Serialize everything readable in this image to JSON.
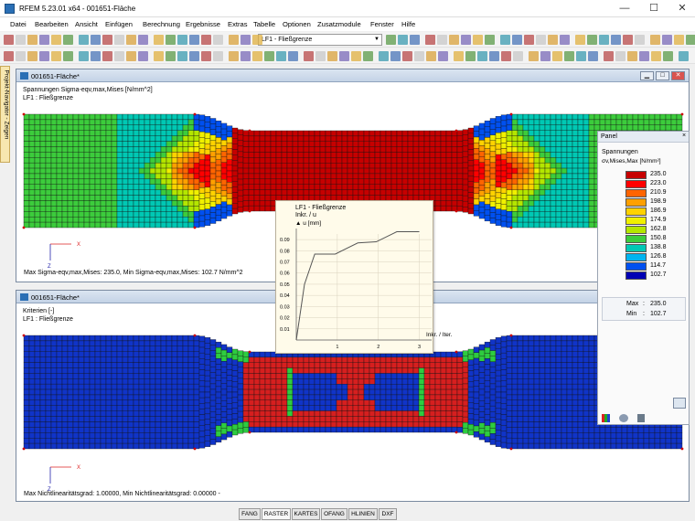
{
  "title": "RFEM 5.23.01 x64 - 001651-Fläche",
  "window_buttons": {
    "minimize": "—",
    "maximize": "☐",
    "close": "✕"
  },
  "menu": [
    "Datei",
    "Bearbeiten",
    "Ansicht",
    "Einfügen",
    "Berechnung",
    "Ergebnisse",
    "Extras",
    "Tabelle",
    "Optionen",
    "Zusatzmodule",
    "Fenster",
    "Hilfe"
  ],
  "toolbar": {
    "loadcase_combo": "LF1 - Fließgrenze"
  },
  "navigator_tab": "Projekt-Navigator - Zeigen",
  "top_window": {
    "title": "001651-Fläche*",
    "info_line1": "Spannungen Sigma-eqv,max,Mises [N/mm^2]",
    "info_line2": "LF1 : Fließgrenze",
    "summary": "Max Sigma-eqv,max,Mises: 235.0, Min Sigma-eqv,max,Mises: 102.7 N/mm^2"
  },
  "bottom_window": {
    "title": "001651-Fläche*",
    "info_line1": "Kriterien [-]",
    "info_line2": "LF1 : Fließgrenze",
    "summary": "Max Nichtlinearitätsgrad: 1.00000, Min Nichtlinearitätsgrad: 0.00000 -"
  },
  "axes": {
    "x": "X",
    "z": "Z"
  },
  "panel": {
    "title": "Panel",
    "close": "×",
    "heading": "Spannungen",
    "subheading": "σv,Mises,Max [N/mm²]",
    "legend": [
      {
        "value": "235.0",
        "color": "#c60000"
      },
      {
        "value": "223.0",
        "color": "#ff0000"
      },
      {
        "value": "210.9",
        "color": "#ff6400"
      },
      {
        "value": "198.9",
        "color": "#ffa000"
      },
      {
        "value": "186.9",
        "color": "#ffd200"
      },
      {
        "value": "174.9",
        "color": "#f0f000"
      },
      {
        "value": "162.8",
        "color": "#b4e600"
      },
      {
        "value": "150.8",
        "color": "#3ccc3c"
      },
      {
        "value": "138.8",
        "color": "#00c8b4"
      },
      {
        "value": "126.8",
        "color": "#00b4f0"
      },
      {
        "value": "114.7",
        "color": "#0050f0"
      },
      {
        "value": "102.7",
        "color": "#0000b4"
      }
    ],
    "max_label": "Max",
    "min_label": "Min",
    "sep": ":",
    "max_value": "235.0",
    "min_value": "102.7"
  },
  "graph": {
    "title": "LF1 - Fließgrenze",
    "subtitle": "Inkr. / u",
    "ylabel": "u [mm]",
    "xlabel": "Inkr. / Iter.",
    "yticks": [
      "0.09",
      "0.08",
      "0.07",
      "0.06",
      "0.05",
      "0.04",
      "0.03",
      "0.02",
      "0.01"
    ],
    "xticks": [
      "1",
      "2",
      "3"
    ]
  },
  "chart_data": {
    "type": "line",
    "title": "LF1 - Fließgrenze",
    "xlabel": "Inkr. / Iter.",
    "ylabel": "u [mm]",
    "xlim": [
      0,
      3.3
    ],
    "ylim": [
      0,
      0.095
    ],
    "grid": true,
    "x": [
      0,
      0.2,
      0.45,
      0.95,
      1.5,
      1.95,
      2.45,
      3.0
    ],
    "y": [
      0.0,
      0.05,
      0.077,
      0.077,
      0.087,
      0.088,
      0.097,
      0.097
    ]
  },
  "statusbar": [
    "FANG",
    "RASTER",
    "KARTES",
    "OFANG",
    "HLINIEN",
    "DXF"
  ]
}
